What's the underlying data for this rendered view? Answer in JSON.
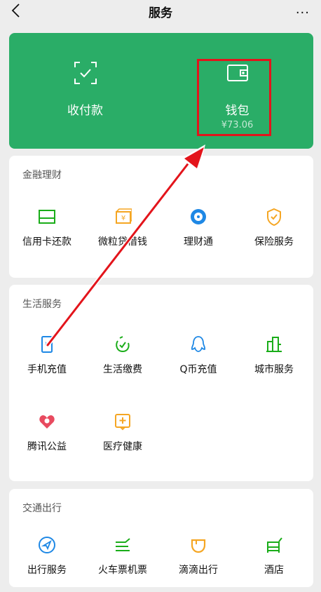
{
  "header": {
    "title": "服务",
    "more": "···"
  },
  "pay": {
    "collect_label": "收付款",
    "wallet_label": "钱包",
    "wallet_balance": "¥73.06"
  },
  "finance": {
    "title": "金融理财",
    "items": [
      {
        "label": "信用卡还款",
        "icon": "credit-card-icon"
      },
      {
        "label": "微粒贷借钱",
        "icon": "loan-icon"
      },
      {
        "label": "理财通",
        "icon": "wealth-icon"
      },
      {
        "label": "保险服务",
        "icon": "insurance-icon"
      }
    ]
  },
  "life": {
    "title": "生活服务",
    "items": [
      {
        "label": "手机充值",
        "icon": "phone-recharge-icon"
      },
      {
        "label": "生活缴费",
        "icon": "utility-icon"
      },
      {
        "label": "Q币充值",
        "icon": "qq-coin-icon"
      },
      {
        "label": "城市服务",
        "icon": "city-icon"
      },
      {
        "label": "腾讯公益",
        "icon": "charity-icon"
      },
      {
        "label": "医疗健康",
        "icon": "medical-icon"
      }
    ]
  },
  "transport": {
    "title": "交通出行",
    "items": [
      {
        "label": "出行服务",
        "icon": "travel-icon"
      },
      {
        "label": "火车票机票",
        "icon": "train-icon"
      },
      {
        "label": "滴滴出行",
        "icon": "didi-icon"
      },
      {
        "label": "酒店",
        "icon": "hotel-icon"
      }
    ]
  },
  "colors": {
    "brand_green": "#2aad67",
    "highlight_red": "#e3141b",
    "finance_green": "#1aad19",
    "orange": "#f5a623",
    "blue": "#1e88e5"
  }
}
